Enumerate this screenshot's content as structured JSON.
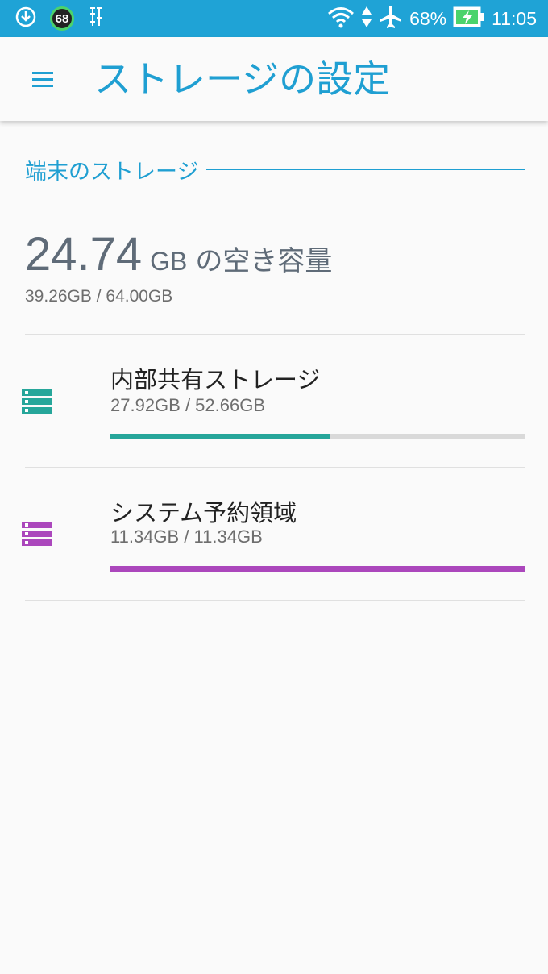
{
  "status_bar": {
    "notification_badge": "68",
    "battery": "68%",
    "time": "11:05",
    "icons": [
      "download-icon",
      "notification-badge",
      "usb-debug-icon",
      "wifi-icon",
      "data-arrows-icon",
      "airplane-icon",
      "battery-charging-icon"
    ]
  },
  "app_bar": {
    "title": "ストレージの設定",
    "menu_icon": "hamburger-menu-icon"
  },
  "section": {
    "title": "端末のストレージ"
  },
  "summary": {
    "free_amount": "24.74",
    "free_unit": "GB",
    "free_label": "の空き容量",
    "usage": "39.26GB / 64.00GB"
  },
  "storage_items": [
    {
      "title": "内部共有ストレージ",
      "usage": "27.92GB / 52.66GB",
      "used_fraction": 0.53,
      "color": "#26a69a",
      "icon": "storage-icon"
    },
    {
      "title": "システム予約領域",
      "usage": "11.34GB / 11.34GB",
      "used_fraction": 1.0,
      "color": "#ab47bc",
      "icon": "storage-icon"
    }
  ],
  "colors": {
    "accent": "#1f9fd2",
    "status_bar": "#1fa3d6",
    "text_primary": "#222222",
    "text_secondary": "#6e6e6e",
    "progress_track": "#d9d9d9"
  }
}
